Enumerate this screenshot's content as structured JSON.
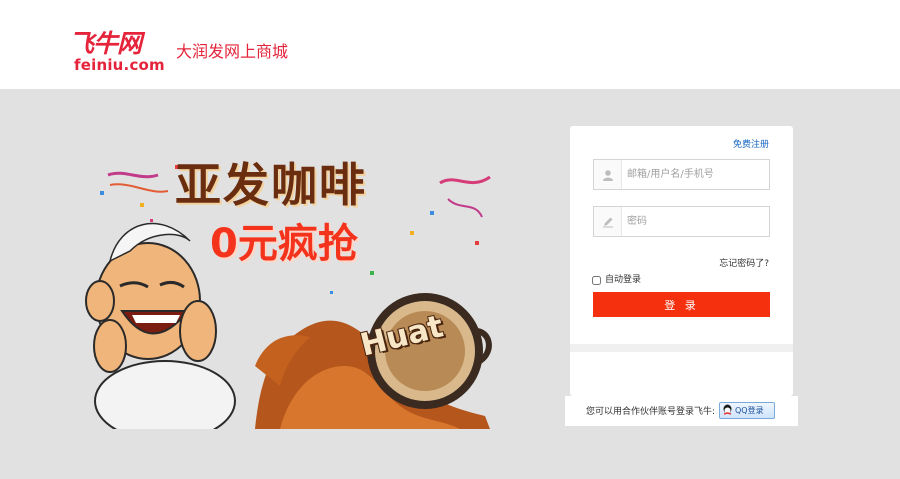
{
  "header": {
    "logo_cn": "飞牛网",
    "logo_en": "feiniu.com",
    "slogan": "大润发网上商城"
  },
  "promo": {
    "title": "亚发咖啡",
    "subtitle": "0元疯抢",
    "badge": "Huat"
  },
  "login": {
    "register_link": "免费注册",
    "username_placeholder": "邮箱/用户名/手机号",
    "password_placeholder": "密码",
    "forgot": "忘记密码了?",
    "remember": "自动登录",
    "submit": "登 录",
    "partner_text": "您可以用合作伙伴账号登录飞牛:",
    "qq_button": "QQ登录"
  },
  "colors": {
    "brand_red": "#e5243b",
    "button_red": "#f4300f",
    "link_blue": "#1565c0",
    "background_gray": "#e1e1e1"
  }
}
